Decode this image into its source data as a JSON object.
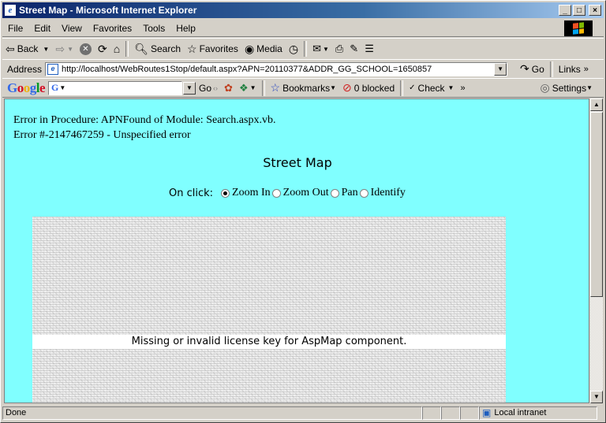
{
  "window": {
    "title": "Street Map - Microsoft Internet Explorer"
  },
  "menu": [
    "File",
    "Edit",
    "View",
    "Favorites",
    "Tools",
    "Help"
  ],
  "toolbar": {
    "back": "Back",
    "search": "Search",
    "favorites": "Favorites",
    "media": "Media"
  },
  "address": {
    "label": "Address",
    "url": "http://localhost/WebRoutes1Stop/default.aspx?APN=20110377&ADDR_GG_SCHOOL=1650857",
    "go": "Go",
    "links": "Links"
  },
  "google": {
    "logo": "Google",
    "go": "Go",
    "bookmarks": "Bookmarks",
    "blocked": "0 blocked",
    "check": "Check",
    "settings": "Settings"
  },
  "page": {
    "error_line1": "Error in Procedure: APNFound of Module: Search.aspx.vb.",
    "error_line2": "Error #-2147467259 - Unspecified error",
    "title": "Street Map",
    "onclick_label": "On click:",
    "options": [
      "Zoom In",
      "Zoom Out",
      "Pan",
      "Identify"
    ],
    "selected_option": "Zoom In",
    "map_message": "Missing or invalid license key for AspMap component."
  },
  "status": {
    "text": "Done",
    "zone": "Local intranet"
  },
  "colors": {
    "page_background": "#80ffff",
    "title_bar": "#0a246a"
  }
}
